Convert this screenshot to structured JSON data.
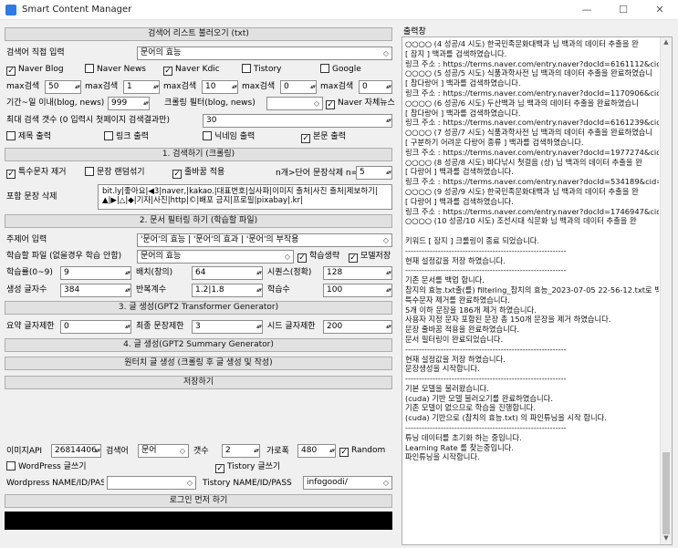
{
  "window": {
    "title": "Smart Content Manager",
    "min": "—",
    "max": "☐",
    "close": "✕"
  },
  "buttons": {
    "load_keywords": "검색어 리스트 불러오기 (txt)",
    "search_crawl": "1. 검색하기 (크롤링)",
    "filter": "2. 문서 필터링 하기 (학습할 파일)",
    "gpt2_transformer": "3. 글 생성(GPT2 Transformer Generator)",
    "gpt2_summary": "4. 글 생성(GPT2 Summary Generator)",
    "oneclick": "원터치 글 생성 (크롤링 후 글 생성 및 작성)",
    "save": "저장하기",
    "login": "로그인 먼저 하기"
  },
  "search": {
    "direct_label": "검색어 직접 입력",
    "direct_value": "문어의 효능",
    "sources": [
      {
        "label": "Naver Blog",
        "checked": true
      },
      {
        "label": "Naver News",
        "checked": false
      },
      {
        "label": "Naver Kdic",
        "checked": true
      },
      {
        "label": "Tistory",
        "checked": false
      },
      {
        "label": "Google",
        "checked": false
      }
    ],
    "max": [
      {
        "label": "max검색",
        "value": "50"
      },
      {
        "label": "max검색",
        "value": "1"
      },
      {
        "label": "max검색",
        "value": "10"
      },
      {
        "label": "max검색",
        "value": "0"
      },
      {
        "label": "max검색",
        "value": "0"
      }
    ],
    "period_label": "기간~일 이내(blog, news)",
    "period_value": "999",
    "crawl_filter_label": "크롤링 필터(blog, news)",
    "crawl_filter_value": "",
    "naver_own_label": "Naver 자체뉴스",
    "naver_own_checked": true,
    "max_count_label": "최대 검색 갯수 (0 입력시 첫페이지 검색결과만)",
    "max_count_value": "30",
    "outputs": [
      {
        "label": "제목 출력",
        "checked": false
      },
      {
        "label": "링크 출력",
        "checked": false
      },
      {
        "label": "닉네임 출력",
        "checked": false
      },
      {
        "label": "본문 출력",
        "checked": true
      }
    ]
  },
  "crawl_opts": {
    "remove_special": "특수문자 제거",
    "remove_special_checked": true,
    "shuffle": "문장 랜덤섞기",
    "shuffle_checked": false,
    "linebreak": "줄바꿈 적용",
    "linebreak_checked": true,
    "n_label": "n개>단어 문장삭제 n=",
    "n_value": "5",
    "delete_label": "포함 문장 삭제",
    "delete_text": "bit.ly|좋아요|◀3|naver,|kakao.|대표번호|실사파|이미지 출처|사진 출처|제보하기|▲|▶|△|◆|기자|사진|http|©|배포 금지|프로필|pixabay|.kr|"
  },
  "filter_opts": {
    "topic_label": "주제어 입력",
    "topic_value": "'문어'의 효능 | '문어'의 효과 | '문어'의 부작용",
    "learn_label": "학습할 파일 (없을경우 학습 안함)",
    "learn_value": "문어의 효능",
    "learn_gen": "학습생략",
    "learn_gen_checked": true,
    "model_save": "모델저장",
    "model_save_checked": true,
    "params_row1": [
      {
        "label": "학습률(0~9)",
        "value": "9"
      },
      {
        "label": "배치(창의)",
        "value": "64"
      },
      {
        "label": "시퀀스(정확)",
        "value": "128"
      }
    ],
    "params_row2": [
      {
        "label": "생성 글자수",
        "value": "384"
      },
      {
        "label": "반복계수",
        "value": "1.2|1.8"
      },
      {
        "label": "학습수",
        "value": "100"
      }
    ]
  },
  "gen_opts": {
    "sum_label": "요약 글자제한",
    "sum_value": "0",
    "final_label": "최종 문장제한",
    "final_value": "3",
    "seed_label": "시드 글자제한",
    "seed_value": "200"
  },
  "image_opts": {
    "api_label": "이미지API",
    "api_value": "26814406",
    "query_label": "검색어",
    "query_value": "문어",
    "count_label": "갯수",
    "count_value": "2",
    "width_label": "가로폭",
    "width_value": "480",
    "random_label": "Random",
    "random_checked": true
  },
  "publish": {
    "wp_label": "WordPress 글쓰기",
    "wp_checked": false,
    "ts_label": "Tistory 글쓰기",
    "ts_checked": true,
    "wp_name_label": "Wordpress NAME/ID/PASS",
    "wp_name_value": "",
    "ts_name_label": "Tistory NAME/ID/PASS",
    "ts_name_value": "infogoodi/"
  },
  "log": {
    "title": "출력창",
    "lines": [
      "○○○○ (4 성공/4 시도) 한국민족문화대백과 님 백과의 데이터 추출을 완",
      "[ 잠지 ] 백과를 검색하였습니다.",
      "링크 주소 : https://terms.naver.com/entry.naver?docId=6161112&cid=67",
      "○○○○ (5 성공/5 시도) 식품과학사전 님 백과의 데이터 추출을 완료하였습니",
      "[ 참다랑어 ] 백과를 검색하였습니다.",
      "링크 주소 : https://terms.naver.com/entry.naver?docId=1170906&cid=40",
      "○○○○ (6 성공/6 시도) 두산백과 님 백과의 데이터 추출을 완료하였습니",
      "[ 참다랑어 ] 백과를 검색하였습니다.",
      "링크 주소 : https://terms.naver.com/entry.naver?docId=6161239&cid=67",
      "○○○○ (7 성공/7 시도) 식품과학사전 님 백과의 데이터 추출을 완료하였습니",
      "[ 구분하기 어려운 다랑어 종류 ] 백과를 검색하였습니다.",
      "링크 주소 : https://terms.naver.com/entry.naver?docId=1977274&cid=42",
      "○○○○ (8 성공/8 시도) 바다낚시 첫걸음 (상) 님 백과의 데이터 추출을 완",
      "[ 다랑어 ] 백과를 검색하였습니다.",
      "링크 주소 : https://terms.naver.com/entry.naver?docId=534189&cid=466",
      "○○○○ (9 성공/9 시도) 한국민족문화대백과 님 백과의 데이터 추출을 완",
      "[ 다랑어 ] 백과를 검색하였습니다.",
      "링크 주소 : https://terms.naver.com/entry.naver?docId=1746947&cid=49",
      "○○○○ (10 성공/10 시도) 조선시대 식문화 님 백과의 데이터 추출을 완",
      "",
      "키워드 [ 잠지 ] 크롤링이 종료 되었습니다.",
      "-----------------------------------------------------------",
      "현재 설정값을 저장 하였습니다.",
      "-----------------------------------------------------------",
      "기존 문서를 백업 합니다.",
      "참지의 효능.txt출(를) filtering_참치의 효능_2023-07-05 22-56-12.txt로 백",
      "특수문자 제거를 완료하였습니다.",
      "5개 이하 문장을 186개 제거 하였습니다.",
      "사용자 지정 문자 포함된 문장 총 150개 문장을 제거 하였습니다.",
      "문장 줄바꿈 적용을 완료하였습니다.",
      "문서 필터링이 완료되었습니다.",
      "-----------------------------------------------------------",
      "현재 설정값을 저장 하였습니다.",
      "문장생성을 시작합니다.",
      "-----------------------------------------------------------",
      "기본 모델을 불러왔습니다.",
      "(cuda) 기반 모델 불러오기를 완료하였습니다.",
      "기존 모델이 없으므로 학습을 진행합니다.",
      "(cuda) 기반으로 (참치의 효능.txt) 의 파인튜닝을 시작 합니다.",
      "-----------------------------------------------------------",
      "튜닝 데이터를 초기화 하는 중입니다.",
      "Learning Rate 를 찾는중입니다.",
      "파인튜닝을 시작합니다."
    ]
  }
}
